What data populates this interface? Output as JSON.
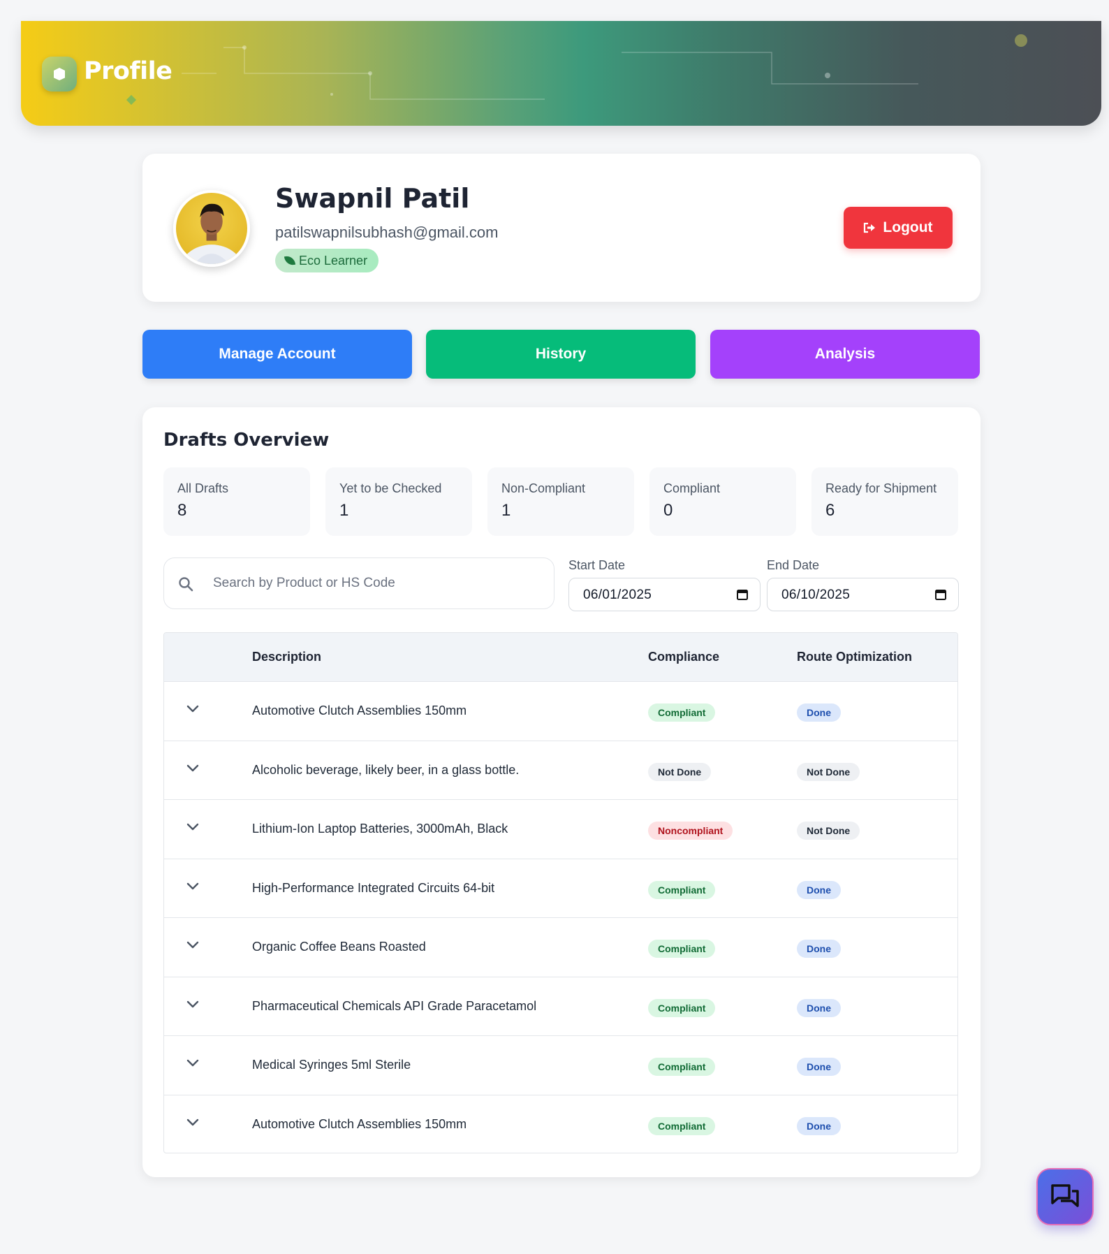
{
  "header": {
    "title": "Profile"
  },
  "profile": {
    "name": "Swapnil Patil",
    "email": "patilswapnilsubhash@gmail.com",
    "badge": "Eco Learner",
    "logout_label": "Logout"
  },
  "nav": {
    "manage_account": "Manage Account",
    "history": "History",
    "analysis": "Analysis"
  },
  "drafts": {
    "title": "Drafts Overview",
    "stats": [
      {
        "label": "All Drafts",
        "value": "8"
      },
      {
        "label": "Yet to be Checked",
        "value": "1"
      },
      {
        "label": "Non-Compliant",
        "value": "1"
      },
      {
        "label": "Compliant",
        "value": "0"
      },
      {
        "label": "Ready for Shipment",
        "value": "6"
      }
    ],
    "search": {
      "placeholder": "Search by Product or HS Code",
      "value": ""
    },
    "start_date": {
      "label": "Start Date",
      "value": "06/01/2025"
    },
    "end_date": {
      "label": "End Date",
      "value": "06/10/2025"
    },
    "table": {
      "columns": [
        "Description",
        "Compliance",
        "Route Optimization"
      ],
      "rows": [
        {
          "description": "Automotive Clutch Assemblies 150mm",
          "compliance": "Compliant",
          "route": "Done"
        },
        {
          "description": "Alcoholic beverage, likely beer, in a glass bottle.",
          "compliance": "Not Done",
          "route": "Not Done"
        },
        {
          "description": "Lithium-Ion Laptop Batteries, 3000mAh, Black",
          "compliance": "Noncompliant",
          "route": "Not Done"
        },
        {
          "description": "High-Performance Integrated Circuits 64-bit",
          "compliance": "Compliant",
          "route": "Done"
        },
        {
          "description": "Organic Coffee Beans Roasted",
          "compliance": "Compliant",
          "route": "Done"
        },
        {
          "description": "Pharmaceutical Chemicals API Grade Paracetamol",
          "compliance": "Compliant",
          "route": "Done"
        },
        {
          "description": "Medical Syringes 5ml Sterile",
          "compliance": "Compliant",
          "route": "Done"
        },
        {
          "description": "Automotive Clutch Assemblies 150mm",
          "compliance": "Compliant",
          "route": "Done"
        }
      ]
    }
  },
  "colors": {
    "logout": "#f0353d",
    "manage_account": "#2e7df7",
    "history": "#06bc7a",
    "analysis": "#a441fb"
  },
  "icons": {
    "logo": "shield-logo-icon",
    "logout": "sign-out-icon",
    "eco": "leaf-icon",
    "search": "search-icon",
    "calendar": "calendar-icon",
    "row_toggle": "chevron-down-icon",
    "chat": "chat-bubbles-icon"
  }
}
